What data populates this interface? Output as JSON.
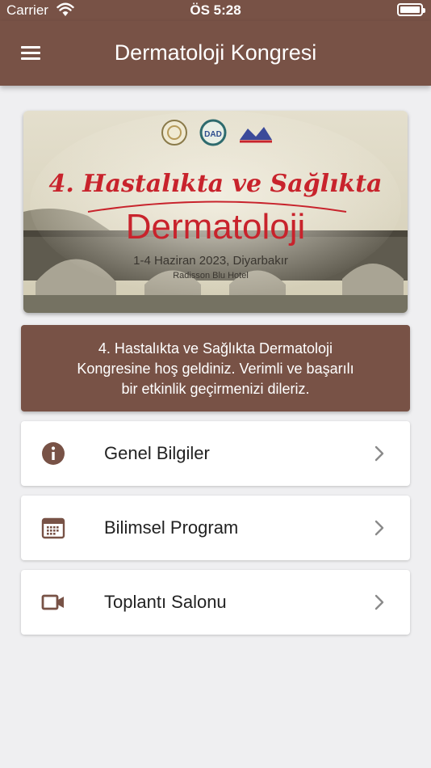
{
  "status_bar": {
    "carrier": "Carrier",
    "time": "ÖS 5:28"
  },
  "app_bar": {
    "title": "Dermatoloji Kongresi"
  },
  "banner": {
    "line1": "4. Hastalıkta ve Sağlıkta",
    "line2": "Dermatoloji",
    "date": "1-4 Haziran 2023, Diyarbakır",
    "venue": "Radisson Blu Hotel"
  },
  "welcome_message": {
    "line1": "4. Hastalıkta ve Sağlıkta Dermatoloji",
    "line2": "Kongresine hoş geldiniz. Verimli ve başarılı",
    "line3": "bir etkinlik geçirmenizi dileriz."
  },
  "menu": [
    {
      "label": "Genel Bilgiler",
      "icon": "info-icon"
    },
    {
      "label": "Bilimsel Program",
      "icon": "calendar-icon"
    },
    {
      "label": "Toplantı Salonu",
      "icon": "video-camera-icon"
    }
  ],
  "colors": {
    "primary": "#785246",
    "background": "#efeff1",
    "banner_red": "#c8232c"
  }
}
